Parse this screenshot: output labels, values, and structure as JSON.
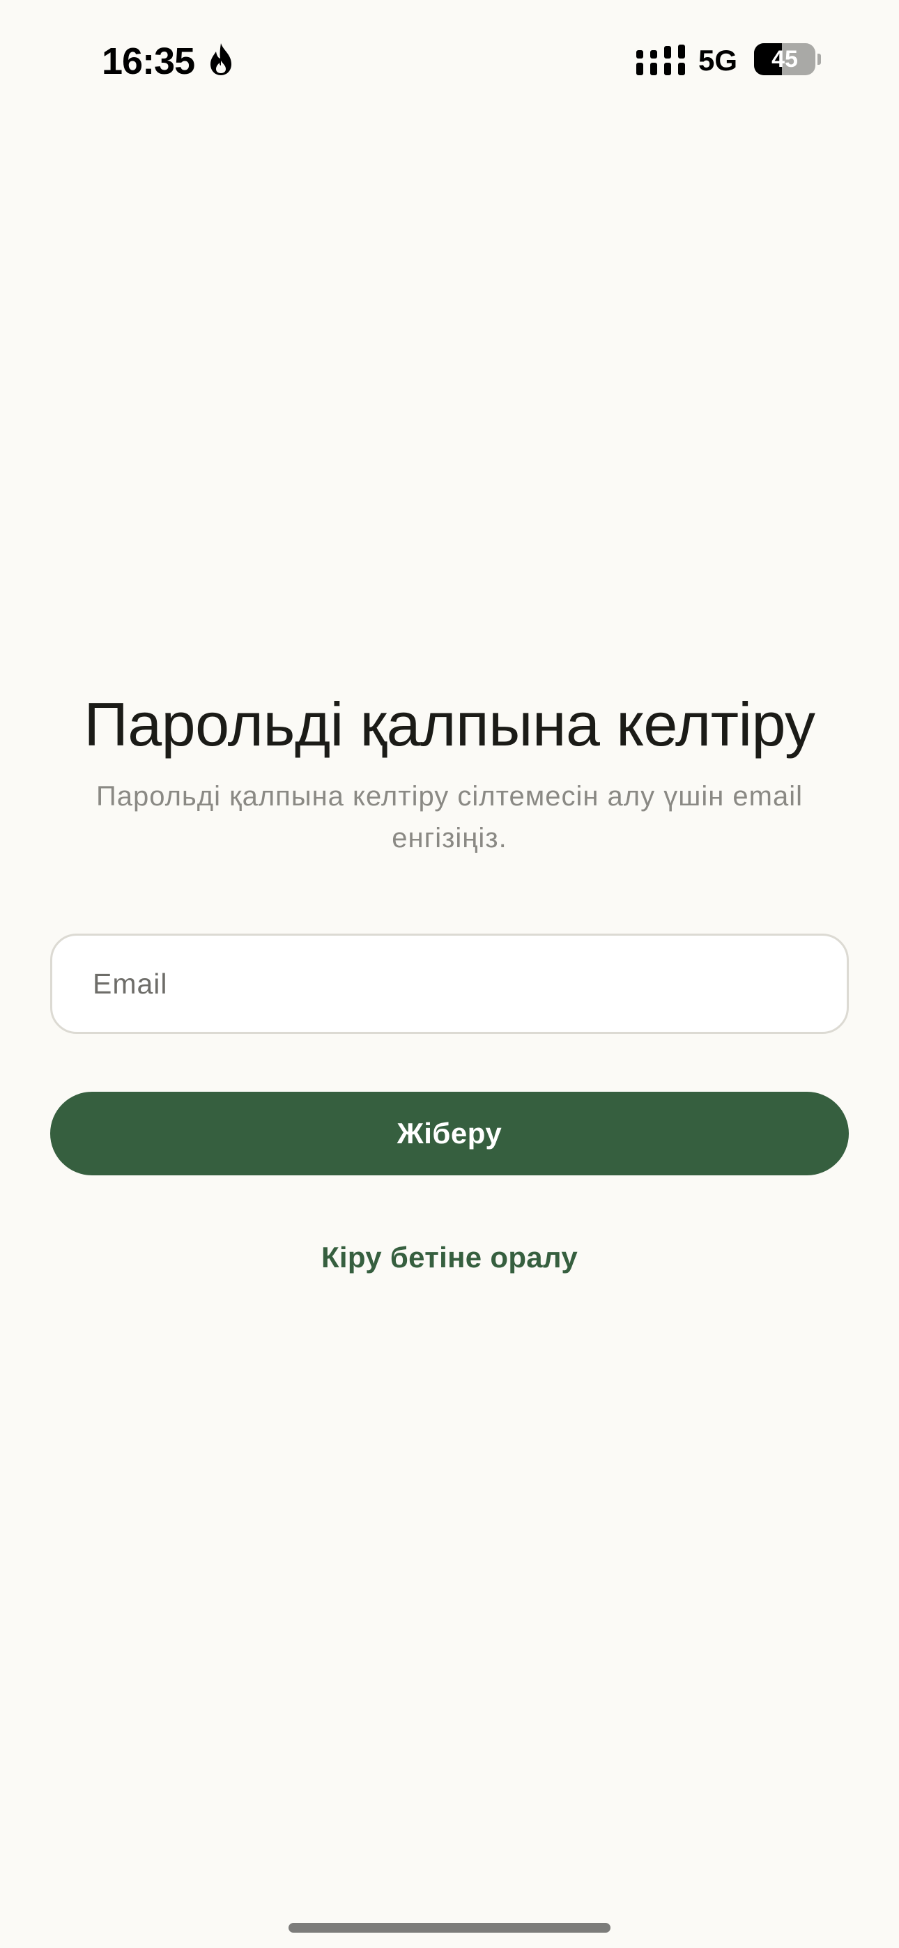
{
  "status_bar": {
    "time": "16:35",
    "network": "5G",
    "battery_level": 45,
    "battery_text": "45",
    "icons": [
      "flame-icon",
      "signal-icon",
      "battery-icon"
    ]
  },
  "reset": {
    "title": "Парольді қалпына келтіру",
    "subtitle": "Парольді қалпына келтіру сілтемесін алу үшін email енгізіңіз.",
    "email_placeholder": "Email",
    "email_value": "",
    "submit_label": "Жіберу",
    "back_link": "Кіру бетіне оралу"
  },
  "colors": {
    "background": "#FBFAF6",
    "accent": "#365F3F",
    "title_text": "#1B1B17",
    "subtitle_text": "#8A8984",
    "field_border": "#DCDAD3"
  }
}
